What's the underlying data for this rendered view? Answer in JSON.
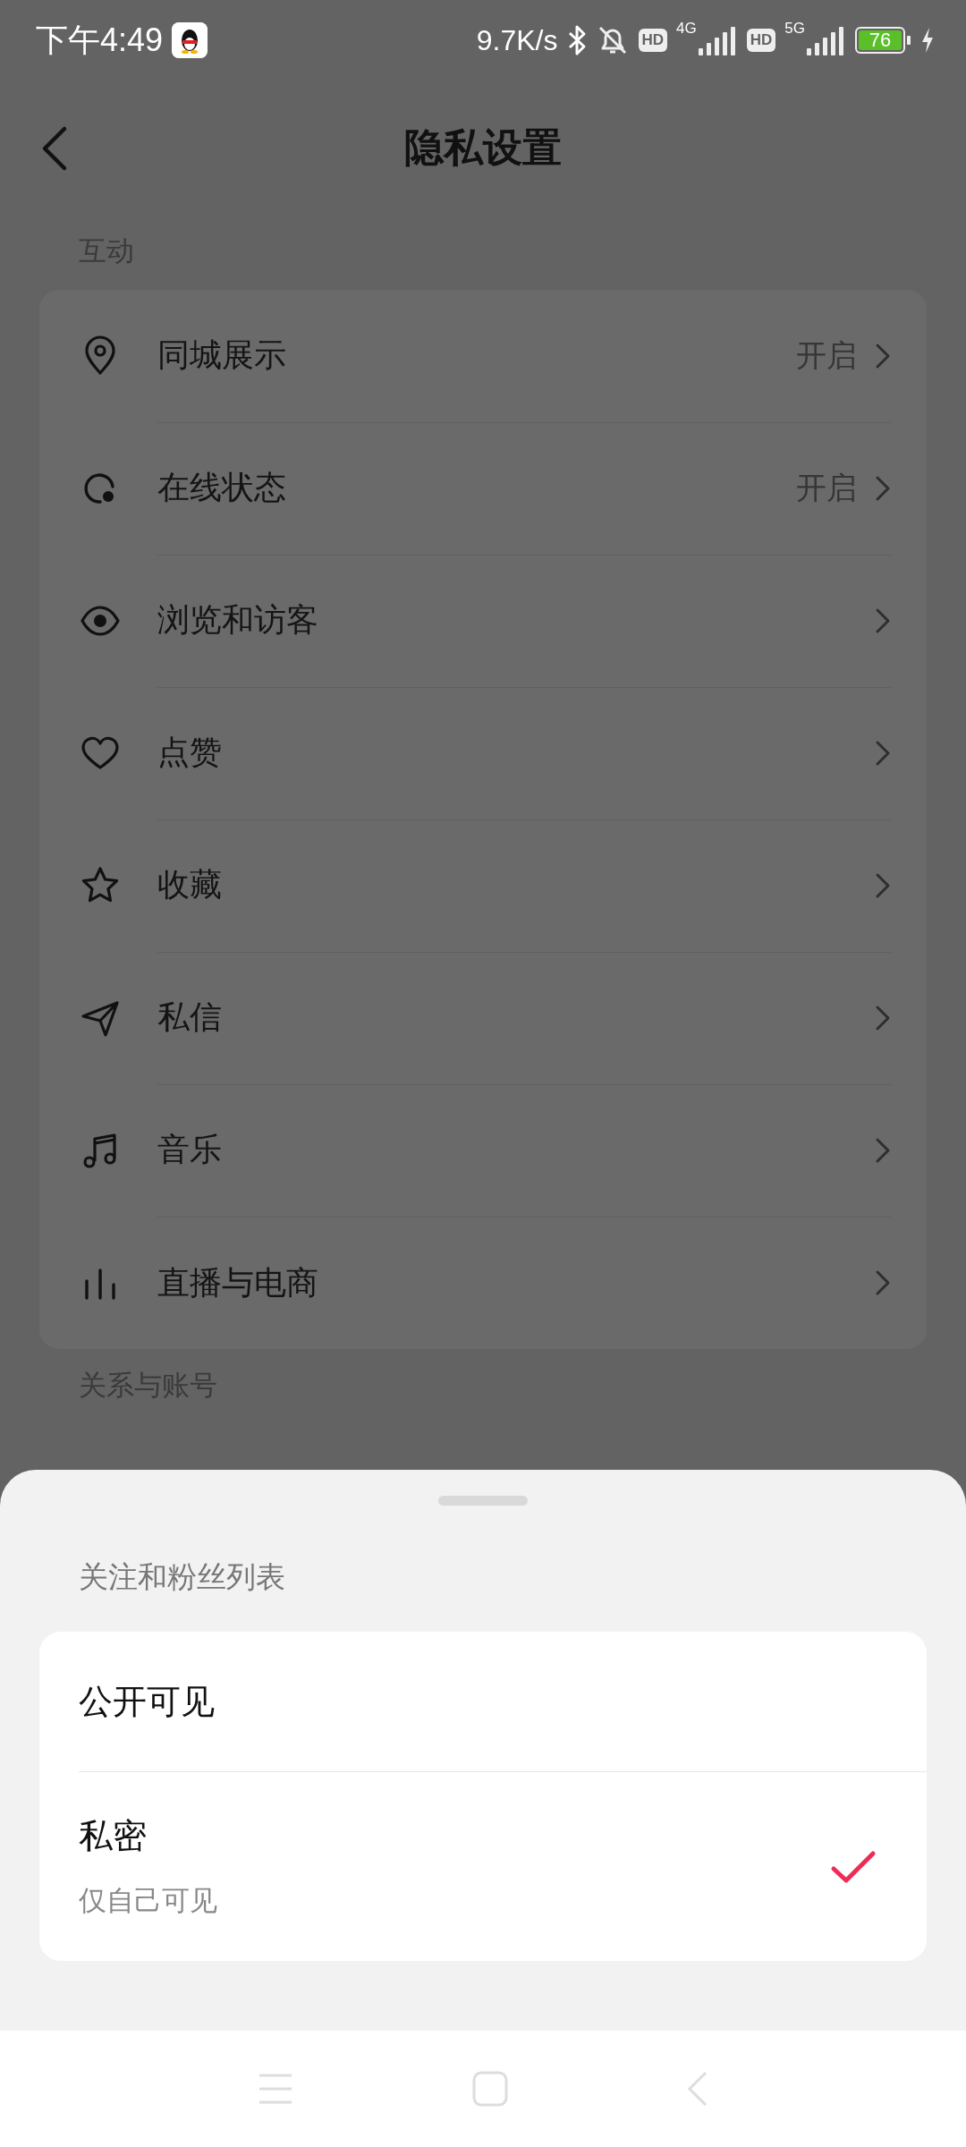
{
  "status_bar": {
    "time": "下午4:49",
    "speed": "9.7K/s",
    "net_1": "4G",
    "net_2": "5G",
    "hd_1": "HD",
    "hd_2": "HD",
    "battery": "76"
  },
  "header": {
    "title": "隐私设置"
  },
  "sections": [
    {
      "label": "互动",
      "items": [
        {
          "label": "同城展示",
          "value": "开启"
        },
        {
          "label": "在线状态",
          "value": "开启"
        },
        {
          "label": "浏览和访客"
        },
        {
          "label": "点赞"
        },
        {
          "label": "收藏"
        },
        {
          "label": "私信"
        },
        {
          "label": "音乐"
        },
        {
          "label": "直播与电商"
        }
      ]
    },
    {
      "label": "关系与账号"
    }
  ],
  "sheet": {
    "title": "关注和粉丝列表",
    "options": [
      {
        "label": "公开可见",
        "selected": false
      },
      {
        "label": "私密",
        "subtitle": "仅自己可见",
        "selected": true
      }
    ]
  }
}
